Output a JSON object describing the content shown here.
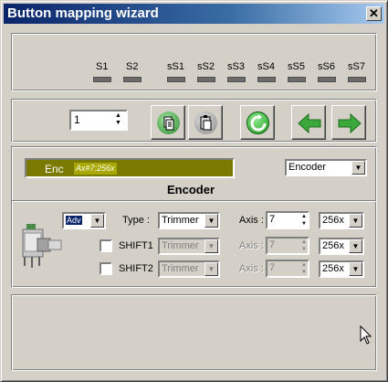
{
  "window": {
    "title": "Button mapping wizard",
    "close_symbol": "✕"
  },
  "buttons_row": [
    "S1",
    "S2",
    "sS1",
    "sS2",
    "sS3",
    "sS4",
    "sS5",
    "sS6",
    "sS7"
  ],
  "toolbar": {
    "spin_value": "1"
  },
  "encoder": {
    "bar_label": "Enc",
    "bar_value": "Ax#7:256x",
    "type_select": "Encoder",
    "title": "Encoder",
    "mode_select": "Adv",
    "rows": [
      {
        "label": "Type :",
        "type": "Trimmer",
        "axis_label": "Axis :",
        "axis": "7",
        "res": "256x",
        "enabled": true
      },
      {
        "label": "SHIFT1",
        "type": "Trimmer",
        "axis_label": "Axis :",
        "axis": "7",
        "res": "256x",
        "enabled": false
      },
      {
        "label": "SHIFT2",
        "type": "Trimmer",
        "axis_label": "Axis :",
        "axis": "7",
        "res": "256x",
        "enabled": false
      }
    ]
  },
  "colors": {
    "title_start": "#0a246a",
    "title_end": "#a6caf0",
    "encoder_bar": "#7a7a00",
    "green": "#3aa83a"
  }
}
